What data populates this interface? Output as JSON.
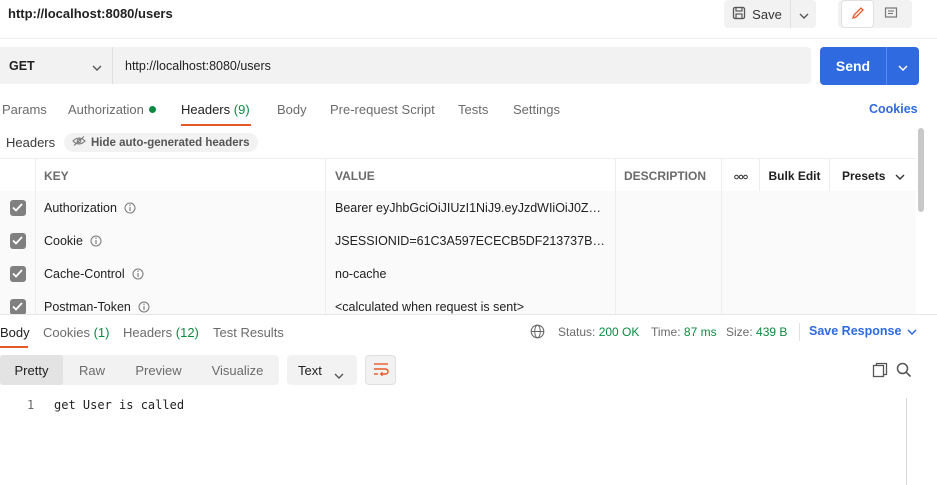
{
  "request": {
    "title": "http://localhost:8080/users",
    "save_label": "Save",
    "method": "GET",
    "url": "http://localhost:8080/users",
    "send_label": "Send"
  },
  "request_tabs": [
    {
      "label": "Params"
    },
    {
      "label": "Authorization"
    },
    {
      "label": "Headers",
      "count": "(9)"
    },
    {
      "label": "Body"
    },
    {
      "label": "Pre-request Script"
    },
    {
      "label": "Tests"
    },
    {
      "label": "Settings"
    }
  ],
  "cookies_link": "Cookies",
  "headers_bar": {
    "label": "Headers",
    "hide_auto": "Hide auto-generated headers"
  },
  "table": {
    "columns": {
      "key": "KEY",
      "value": "VALUE",
      "description": "DESCRIPTION",
      "more": "ooo",
      "bulk_edit": "Bulk Edit",
      "presets": "Presets"
    },
    "rows": [
      {
        "key": "Authorization",
        "value": "Bearer eyJhbGciOiJIUzI1NiJ9.eyJzdWIiOiJ0ZX..."
      },
      {
        "key": "Cookie",
        "value": "JSESSIONID=61C3A597ECECB5DF213737B6B..."
      },
      {
        "key": "Cache-Control",
        "value": "no-cache"
      },
      {
        "key": "Postman-Token",
        "value": "<calculated when request is sent>"
      }
    ]
  },
  "response": {
    "tabs": [
      {
        "label": "Body"
      },
      {
        "label": "Cookies",
        "count": "(1)"
      },
      {
        "label": "Headers",
        "count": "(12)"
      },
      {
        "label": "Test Results"
      }
    ],
    "status_label": "Status:",
    "status_value": "200 OK",
    "time_label": "Time:",
    "time_value": "87 ms",
    "size_label": "Size:",
    "size_value": "439 B",
    "save_response": "Save Response",
    "formats": [
      "Pretty",
      "Raw",
      "Preview",
      "Visualize"
    ],
    "text_type": "Text",
    "line_number": "1",
    "body_text": "get User is called"
  },
  "colors": {
    "accent": "#2f6ae0",
    "success": "#0b8a41",
    "active_tab_underline": "#e8592a",
    "wrap_icon": "#e8592a"
  },
  "icons": [
    "save-icon",
    "chevron-down-icon",
    "pencil-icon",
    "comment-icon",
    "info-icon",
    "eye-off-icon",
    "globe-icon",
    "copy-icon",
    "search-icon",
    "wrap-lines-icon",
    "checkbox-checked-icon"
  ]
}
